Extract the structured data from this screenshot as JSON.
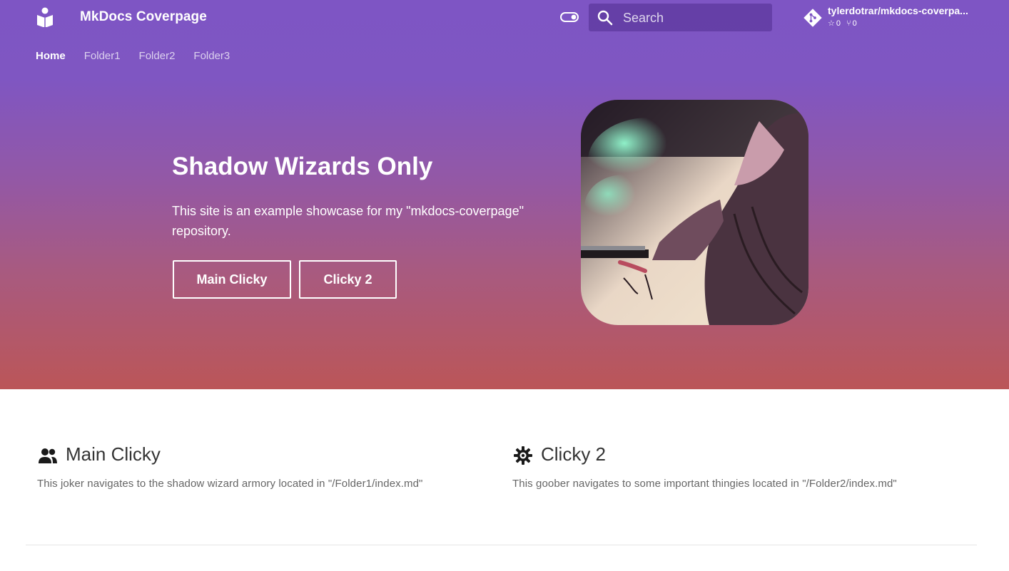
{
  "header": {
    "site_title": "MkDocs Coverpage",
    "logo_icon": "book-reader-icon",
    "toggle_icon": "toggle-switch-icon",
    "search": {
      "placeholder": "Search",
      "icon": "search-icon"
    },
    "repo": {
      "name": "tylerdotrar/mkdocs-coverpa...",
      "icon": "git-icon",
      "stars": "0",
      "forks": "0"
    }
  },
  "tabs": [
    {
      "label": "Home",
      "active": true
    },
    {
      "label": "Folder1",
      "active": false
    },
    {
      "label": "Folder2",
      "active": false
    },
    {
      "label": "Folder3",
      "active": false
    }
  ],
  "hero": {
    "title": "Shadow Wizards Only",
    "text": "This site is an example showcase for my \"mkdocs-coverpage\" repository.",
    "buttons": [
      {
        "label": "Main Clicky"
      },
      {
        "label": "Clicky 2"
      }
    ]
  },
  "features": [
    {
      "icon": "people-icon",
      "title": "Main Clicky",
      "text": "This joker navigates to the shadow wizard armory located in \"/Folder1/index.md\""
    },
    {
      "icon": "cog-icon",
      "title": "Clicky 2",
      "text": "This goober navigates to some important thingies located in \"/Folder2/index.md\""
    }
  ],
  "colors": {
    "gradient_top": "#7e55c4",
    "gradient_bottom": "#bb5658",
    "accent": "#ffffff"
  }
}
